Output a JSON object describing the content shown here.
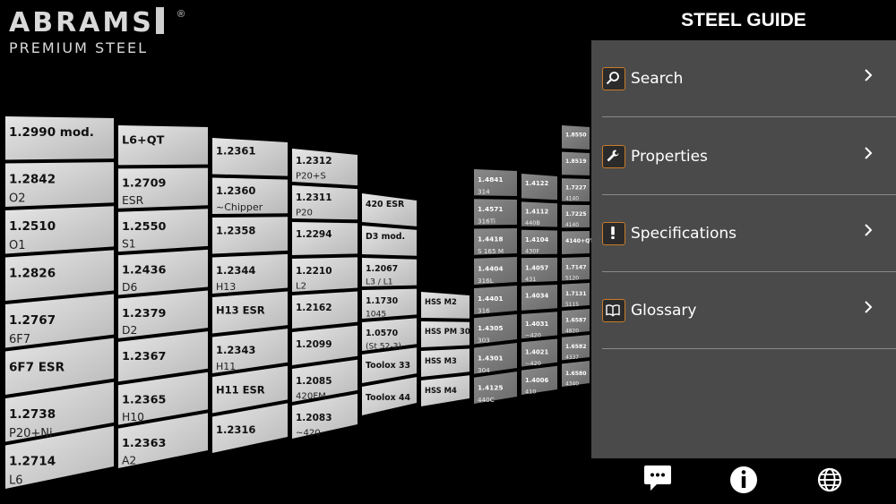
{
  "logo": {
    "brand": "ABRAMS",
    "registered": "®",
    "tagline": "PREMIUM STEEL"
  },
  "guide": {
    "title": "STEEL GUIDE"
  },
  "menu": [
    {
      "label": "Search",
      "icon": "search-icon"
    },
    {
      "label": "Properties",
      "icon": "wrench-icon"
    },
    {
      "label": "Specifications",
      "icon": "exclamation-icon"
    },
    {
      "label": "Glossary",
      "icon": "book-icon"
    }
  ],
  "bottom": [
    "chat-icon",
    "info-icon",
    "globe-icon"
  ],
  "colors": {
    "accent": "#c87c2a",
    "panel": "#4a4a4a",
    "background": "#000000"
  },
  "columns": [
    {
      "tiles": [
        [
          "1.2990 mod.",
          ""
        ],
        [
          "1.2842",
          "O2"
        ],
        [
          "1.2510",
          "O1"
        ],
        [
          "1.2826",
          ""
        ],
        [
          "1.2767",
          "6F7"
        ],
        [
          "6F7 ESR",
          ""
        ],
        [
          "1.2738",
          "P20+Ni"
        ],
        [
          "1.2714",
          "L6"
        ]
      ]
    },
    {
      "tiles": [
        [
          "L6+QT",
          ""
        ],
        [
          "1.2709",
          "ESR"
        ],
        [
          "1.2550",
          "S1"
        ],
        [
          "1.2436",
          "D6"
        ],
        [
          "1.2379",
          "D2"
        ],
        [
          "1.2367",
          ""
        ],
        [
          "1.2365",
          "H10"
        ],
        [
          "1.2363",
          "A2"
        ]
      ]
    },
    {
      "tiles": [
        [
          "1.2361",
          ""
        ],
        [
          "1.2360",
          "~Chipper"
        ],
        [
          "1.2358",
          ""
        ],
        [
          "1.2344",
          "H13"
        ],
        [
          "H13 ESR",
          ""
        ],
        [
          "1.2343",
          "H11"
        ],
        [
          "H11 ESR",
          ""
        ],
        [
          "1.2316",
          ""
        ]
      ]
    },
    {
      "tiles": [
        [
          "1.2312",
          "P20+S"
        ],
        [
          "1.2311",
          "P20"
        ],
        [
          "1.2294",
          ""
        ],
        [
          "1.2210",
          "L2"
        ],
        [
          "1.2162",
          ""
        ],
        [
          "1.2099",
          ""
        ],
        [
          "1.2085",
          "420FM"
        ],
        [
          "1.2083",
          "~420"
        ]
      ]
    },
    {
      "tiles": [
        [
          "420 ESR",
          ""
        ],
        [
          "D3 mod.",
          ""
        ],
        [
          "1.2067",
          "L3 / L1"
        ],
        [
          "1.1730",
          "1045"
        ],
        [
          "1.0570",
          "(St 52-3)"
        ],
        [
          "Toolox 33",
          ""
        ],
        [
          "Toolox 44",
          ""
        ]
      ]
    },
    {
      "tiles": [
        [
          "HSS M2",
          ""
        ],
        [
          "HSS PM 30",
          ""
        ],
        [
          "HSS M3",
          ""
        ],
        [
          "HSS M4",
          ""
        ]
      ]
    },
    {
      "tiles": [
        [
          "1.4841",
          "314"
        ],
        [
          "1.4571",
          "316Ti"
        ],
        [
          "1.4418",
          "S 165 M"
        ],
        [
          "1.4404",
          "316L"
        ],
        [
          "1.4401",
          "316"
        ],
        [
          "1.4305",
          "303"
        ],
        [
          "1.4301",
          "304"
        ],
        [
          "1.4125",
          "440C"
        ]
      ]
    },
    {
      "tiles": [
        [
          "1.4122",
          ""
        ],
        [
          "1.4112",
          "440B"
        ],
        [
          "1.4104",
          "430F"
        ],
        [
          "1.4057",
          "431"
        ],
        [
          "1.4034",
          ""
        ],
        [
          "1.4031",
          "~420"
        ],
        [
          "1.4021",
          "~420"
        ],
        [
          "1.4006",
          "410"
        ]
      ]
    },
    {
      "tiles": [
        [
          "1.8550",
          ""
        ],
        [
          "1.8519",
          ""
        ],
        [
          "1.7227",
          "4140"
        ],
        [
          "1.7225",
          "4140"
        ],
        [
          "4140+QT",
          ""
        ],
        [
          "1.7147",
          "5120"
        ],
        [
          "1.7131",
          "5115"
        ],
        [
          "1.6587",
          "4820"
        ],
        [
          "1.6582",
          "4337"
        ],
        [
          "1.6580",
          "4340"
        ]
      ]
    }
  ]
}
